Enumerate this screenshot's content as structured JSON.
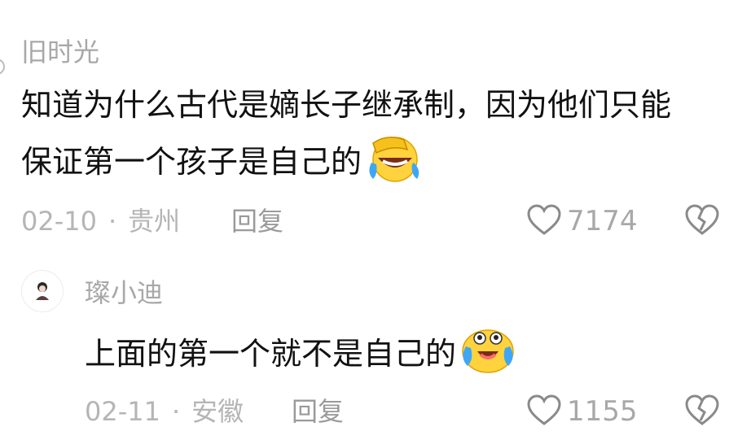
{
  "comments": [
    {
      "author": "旧时光",
      "lines": [
        "知道为什么古代是嫡长子继承制，因为他们只能",
        "保证第一个孩子是自己的"
      ],
      "emoji": "facepalm-laugh-emoji",
      "date": "02-10",
      "separator": "·",
      "location": "贵州",
      "reply_label": "回复",
      "likes": "7174"
    },
    {
      "author": "璨小迪",
      "lines": [
        "上面的第一个就不是自己的"
      ],
      "emoji": "crying-laugh-emoji",
      "date": "02-11",
      "separator": "·",
      "location": "安徽",
      "reply_label": "回复",
      "likes": "1155"
    }
  ],
  "colors": {
    "text": "#111111",
    "meta": "#b5b5b5",
    "icon": "#8a8a8a",
    "emoji_face": "#ffd33d"
  }
}
